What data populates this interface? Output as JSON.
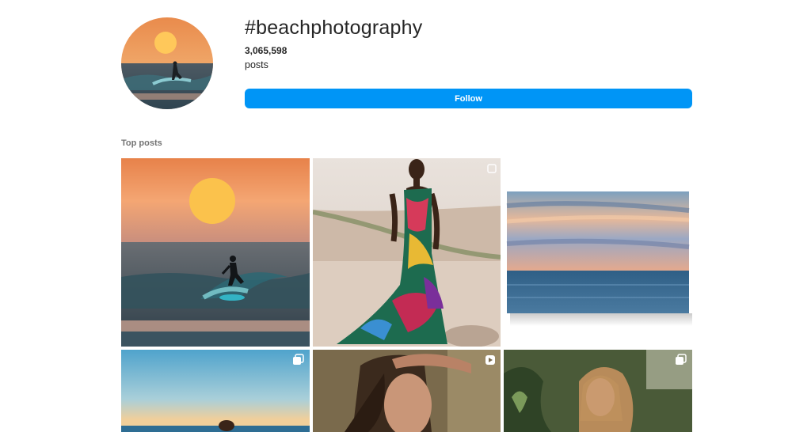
{
  "hashtag": {
    "title": "#beachphotography",
    "post_count": "3,065,598",
    "post_count_label": "posts",
    "follow_label": "Follow"
  },
  "section": {
    "top_posts_label": "Top posts"
  },
  "colors": {
    "accent": "#0095f6",
    "text": "#262626",
    "muted": "#737373",
    "background": "#ffffff"
  },
  "posts": [
    {
      "subject": "surfer at sunset",
      "overlay_icon": "none"
    },
    {
      "subject": "woman in sequin gown on beach",
      "overlay_icon": "multiple-photos-icon"
    },
    {
      "subject": "blurred ocean horizon at dusk",
      "overlay_icon": "none"
    },
    {
      "subject": "swimmer in sea at dawn",
      "overlay_icon": "multiple-photos-icon"
    },
    {
      "subject": "woman shielding eyes from sun",
      "overlay_icon": "reel-icon"
    },
    {
      "subject": "woman in greenery",
      "overlay_icon": "multiple-photos-icon"
    }
  ]
}
